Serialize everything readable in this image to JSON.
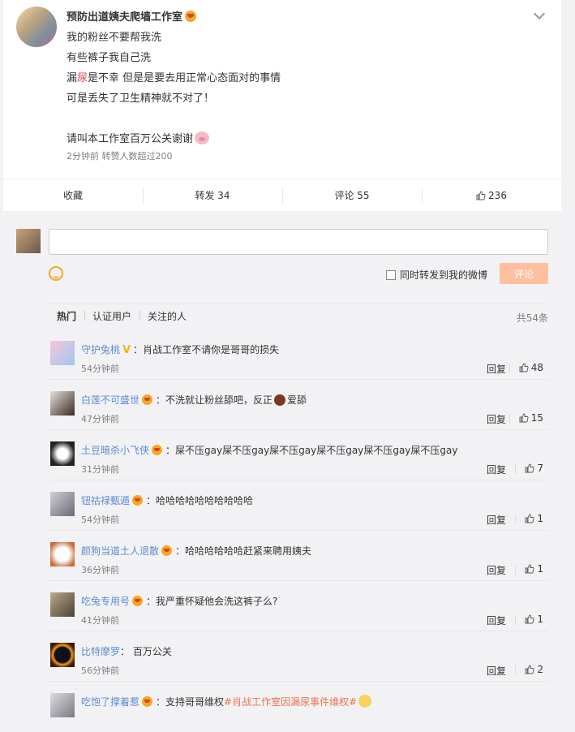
{
  "post": {
    "author": "预防出道姨夫爬墙工作室",
    "lines": {
      "l1": "我的粉丝不要帮我洗",
      "l2": "有些裤子我自己洗",
      "l3a": "漏",
      "l3b": "尿",
      "l3c": "是不幸 但是是要去用正常心态面对的事情",
      "l4": "可是丢失了卫生精神就不对了！",
      "l5": "请叫本工作室百万公关谢谢"
    },
    "meta": "2分钟前 转赞人数超过200",
    "actions": {
      "favorite": "收藏",
      "repost": "转发 34",
      "comment": "评论 55",
      "like": "236"
    }
  },
  "composer": {
    "forward_label": "同时转发到我的微博",
    "submit_label": "评论"
  },
  "tabs": {
    "hot": "热门",
    "verified": "认证用户",
    "following": "关注的人",
    "total": "共54条"
  },
  "comments": [
    {
      "name": "守护兔桃",
      "text": "肖战工作室不请你是哥哥的损失",
      "time": "54分钟前",
      "reply": "回复",
      "likes": "48"
    },
    {
      "name": "白莲不可盛世",
      "text_a": "不洗就让粉丝舔吧，反正",
      "text_b": "爱舔",
      "time": "47分钟前",
      "reply": "回复",
      "likes": "15"
    },
    {
      "name": "土豆暗杀小飞侠",
      "text": "屎不压gay屎不压gay屎不压gay屎不压gay屎不压gay屎不压gay",
      "time": "31分钟前",
      "reply": "回复",
      "likes": "7"
    },
    {
      "name": "钮祜禄甄遁",
      "text": "哈哈哈哈哈哈哈哈哈哈",
      "time": "54分钟前",
      "reply": "回复",
      "likes": "1"
    },
    {
      "name": "颜狗当道土人退散",
      "text": "哈哈哈哈哈哈赶紧来聘用姨夫",
      "time": "36分钟前",
      "reply": "回复",
      "likes": "1"
    },
    {
      "name": "吃兔专用号",
      "text": "我严重怀疑他会洗这裤子么?",
      "time": "41分钟前",
      "reply": "回复",
      "likes": "1"
    },
    {
      "name": "比特摩罗",
      "text": "百万公关",
      "time": "56分钟前",
      "reply": "回复",
      "likes": "2"
    },
    {
      "name": "吃饱了撑着惹",
      "text_a": "支持哥哥维权",
      "hashtag": "#肖战工作室因漏尿事件维权#"
    }
  ]
}
